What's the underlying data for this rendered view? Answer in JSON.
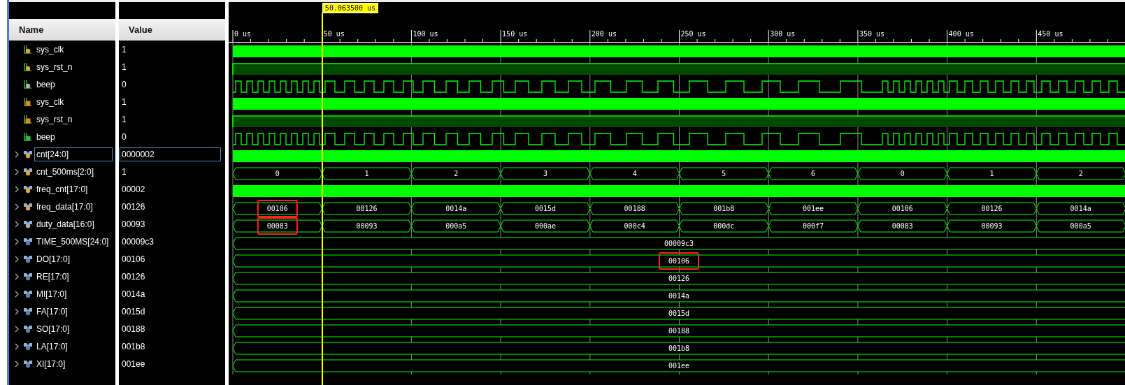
{
  "columns": {
    "name": "Name",
    "value": "Value"
  },
  "cursor": {
    "label": "50.063500 us"
  },
  "timeline": {
    "ticks": [
      "0 us",
      "50 us",
      "100 us",
      "150 us",
      "200 us",
      "250 us",
      "300 us",
      "350 us",
      "400 us",
      "450 us"
    ]
  },
  "signals": [
    {
      "name": "sys_clk",
      "value": "1",
      "icon": {
        "kind": "in"
      },
      "wave": {
        "kind": "clock"
      },
      "expandable": false,
      "selected": false
    },
    {
      "name": "sys_rst_n",
      "value": "1",
      "icon": {
        "kind": "in"
      },
      "wave": {
        "kind": "high"
      },
      "expandable": false,
      "selected": false
    },
    {
      "name": "beep",
      "value": "0",
      "icon": {
        "kind": "out"
      },
      "wave": {
        "kind": "pulse"
      },
      "expandable": false,
      "selected": false
    },
    {
      "name": "sys_clk",
      "value": "1",
      "icon": {
        "kind": "reg"
      },
      "wave": {
        "kind": "clock"
      },
      "expandable": false,
      "selected": false
    },
    {
      "name": "sys_rst_n",
      "value": "1",
      "icon": {
        "kind": "reg"
      },
      "wave": {
        "kind": "high"
      },
      "expandable": false,
      "selected": false
    },
    {
      "name": "beep",
      "value": "0",
      "icon": {
        "kind": "regout"
      },
      "wave": {
        "kind": "pulse"
      },
      "expandable": false,
      "selected": false
    },
    {
      "name": "cnt[24:0]",
      "value": "0000002",
      "icon": {
        "kind": "in"
      },
      "wave": {
        "kind": "clock"
      },
      "expandable": true,
      "selected": true
    },
    {
      "name": "cnt_500ms[2:0]",
      "value": "1",
      "icon": {
        "kind": "in"
      },
      "wave": {
        "kind": "bus"
      },
      "expandable": true,
      "selected": false,
      "segments": [
        {
          "text": "0",
          "highlighted": false
        },
        {
          "text": "1",
          "highlighted": false
        },
        {
          "text": "2",
          "highlighted": false
        },
        {
          "text": "3",
          "highlighted": false
        },
        {
          "text": "4",
          "highlighted": false
        },
        {
          "text": "5",
          "highlighted": false
        },
        {
          "text": "6",
          "highlighted": false
        },
        {
          "text": "0",
          "highlighted": false
        },
        {
          "text": "1",
          "highlighted": false
        },
        {
          "text": "2",
          "highlighted": false
        }
      ]
    },
    {
      "name": "freq_cnt[17:0]",
      "value": "00002",
      "icon": {
        "kind": "in"
      },
      "wave": {
        "kind": "clock"
      },
      "expandable": true,
      "selected": false
    },
    {
      "name": "freq_data[17:0]",
      "value": "00126",
      "icon": {
        "kind": "in"
      },
      "wave": {
        "kind": "bus"
      },
      "expandable": true,
      "selected": false,
      "segments": [
        {
          "text": "00106",
          "highlighted": true
        },
        {
          "text": "00126",
          "highlighted": false
        },
        {
          "text": "0014a",
          "highlighted": false
        },
        {
          "text": "0015d",
          "highlighted": false
        },
        {
          "text": "00188",
          "highlighted": false
        },
        {
          "text": "001b8",
          "highlighted": false
        },
        {
          "text": "001ee",
          "highlighted": false
        },
        {
          "text": "00106",
          "highlighted": false
        },
        {
          "text": "00126",
          "highlighted": false
        },
        {
          "text": "0014a",
          "highlighted": false
        }
      ]
    },
    {
      "name": "duty_data[16:0]",
      "value": "00093",
      "icon": {
        "kind": "out"
      },
      "wave": {
        "kind": "bus"
      },
      "expandable": true,
      "selected": false,
      "segments": [
        {
          "text": "00083",
          "highlighted": true
        },
        {
          "text": "00093",
          "highlighted": false
        },
        {
          "text": "000a5",
          "highlighted": false
        },
        {
          "text": "000ae",
          "highlighted": false
        },
        {
          "text": "000c4",
          "highlighted": false
        },
        {
          "text": "000dc",
          "highlighted": false
        },
        {
          "text": "000f7",
          "highlighted": false
        },
        {
          "text": "00083",
          "highlighted": false
        },
        {
          "text": "00093",
          "highlighted": false
        },
        {
          "text": "000a5",
          "highlighted": false
        }
      ]
    },
    {
      "name": "TIME_500MS[24:0]",
      "value": "00009c3",
      "icon": {
        "kind": "const"
      },
      "wave": {
        "kind": "bus"
      },
      "expandable": true,
      "selected": false,
      "segments": [
        {
          "text": "00009c3",
          "highlighted": false
        }
      ]
    },
    {
      "name": "DO[17:0]",
      "value": "00106",
      "icon": {
        "kind": "const"
      },
      "wave": {
        "kind": "bus"
      },
      "expandable": true,
      "selected": false,
      "segments": [
        {
          "text": "00106",
          "highlighted": true
        }
      ]
    },
    {
      "name": "RE[17:0]",
      "value": "00126",
      "icon": {
        "kind": "const"
      },
      "wave": {
        "kind": "bus"
      },
      "expandable": true,
      "selected": false,
      "segments": [
        {
          "text": "00126",
          "highlighted": false
        }
      ]
    },
    {
      "name": "MI[17:0]",
      "value": "0014a",
      "icon": {
        "kind": "const"
      },
      "wave": {
        "kind": "bus"
      },
      "expandable": true,
      "selected": false,
      "segments": [
        {
          "text": "0014a",
          "highlighted": false
        }
      ]
    },
    {
      "name": "FA[17:0]",
      "value": "0015d",
      "icon": {
        "kind": "const"
      },
      "wave": {
        "kind": "bus"
      },
      "expandable": true,
      "selected": false,
      "segments": [
        {
          "text": "0015d",
          "highlighted": false
        }
      ]
    },
    {
      "name": "SO[17:0]",
      "value": "00188",
      "icon": {
        "kind": "const"
      },
      "wave": {
        "kind": "bus"
      },
      "expandable": true,
      "selected": false,
      "segments": [
        {
          "text": "00188",
          "highlighted": false
        }
      ]
    },
    {
      "name": "LA[17:0]",
      "value": "001b8",
      "icon": {
        "kind": "const"
      },
      "wave": {
        "kind": "bus"
      },
      "expandable": true,
      "selected": false,
      "segments": [
        {
          "text": "001b8",
          "highlighted": false
        }
      ]
    },
    {
      "name": "XI[17:0]",
      "value": "001ee",
      "icon": {
        "kind": "const"
      },
      "wave": {
        "kind": "bus"
      },
      "expandable": true,
      "selected": false,
      "segments": [
        {
          "text": "001ee",
          "highlighted": false
        }
      ]
    }
  ]
}
